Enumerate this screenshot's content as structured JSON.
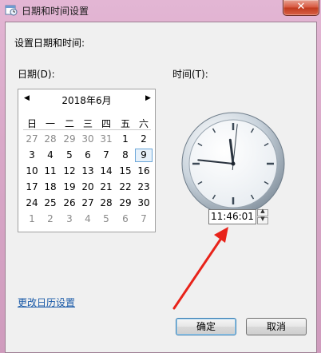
{
  "window": {
    "title": "日期和时间设置",
    "close_glyph": "✕"
  },
  "heading": "设置日期和时间:",
  "date_label": "日期(D):",
  "time_label": "时间(T):",
  "calendar": {
    "prev": "◀",
    "next": "▶",
    "month_title": "2018年6月",
    "weekdays": [
      "日",
      "一",
      "二",
      "三",
      "四",
      "五",
      "六"
    ],
    "weeks": [
      [
        {
          "d": "27",
          "o": true
        },
        {
          "d": "28",
          "o": true
        },
        {
          "d": "29",
          "o": true
        },
        {
          "d": "30",
          "o": true
        },
        {
          "d": "31",
          "o": true
        },
        {
          "d": "1"
        },
        {
          "d": "2"
        }
      ],
      [
        {
          "d": "3"
        },
        {
          "d": "4"
        },
        {
          "d": "5"
        },
        {
          "d": "6"
        },
        {
          "d": "7"
        },
        {
          "d": "8"
        },
        {
          "d": "9",
          "s": true
        }
      ],
      [
        {
          "d": "10"
        },
        {
          "d": "11"
        },
        {
          "d": "12"
        },
        {
          "d": "13"
        },
        {
          "d": "14"
        },
        {
          "d": "15"
        },
        {
          "d": "16"
        }
      ],
      [
        {
          "d": "17"
        },
        {
          "d": "18"
        },
        {
          "d": "19"
        },
        {
          "d": "20"
        },
        {
          "d": "21"
        },
        {
          "d": "22"
        },
        {
          "d": "23"
        }
      ],
      [
        {
          "d": "24"
        },
        {
          "d": "25"
        },
        {
          "d": "26"
        },
        {
          "d": "27"
        },
        {
          "d": "28"
        },
        {
          "d": "29"
        },
        {
          "d": "30"
        }
      ],
      [
        {
          "d": "1",
          "o": true
        },
        {
          "d": "2",
          "o": true
        },
        {
          "d": "3",
          "o": true
        },
        {
          "d": "4",
          "o": true
        },
        {
          "d": "5",
          "o": true
        },
        {
          "d": "6",
          "o": true
        },
        {
          "d": "7",
          "o": true
        }
      ]
    ]
  },
  "clock": {
    "hour": 11,
    "minute": 46,
    "second": 1
  },
  "time_value": "11:46:01",
  "spin_up": "▲",
  "spin_down": "▼",
  "change_calendar_link": "更改日历设置",
  "buttons": {
    "ok": "确定",
    "cancel": "取消"
  },
  "colors": {
    "annotation_arrow": "#e8231a",
    "link": "#1a5aa8",
    "close": "#c13a1e"
  }
}
